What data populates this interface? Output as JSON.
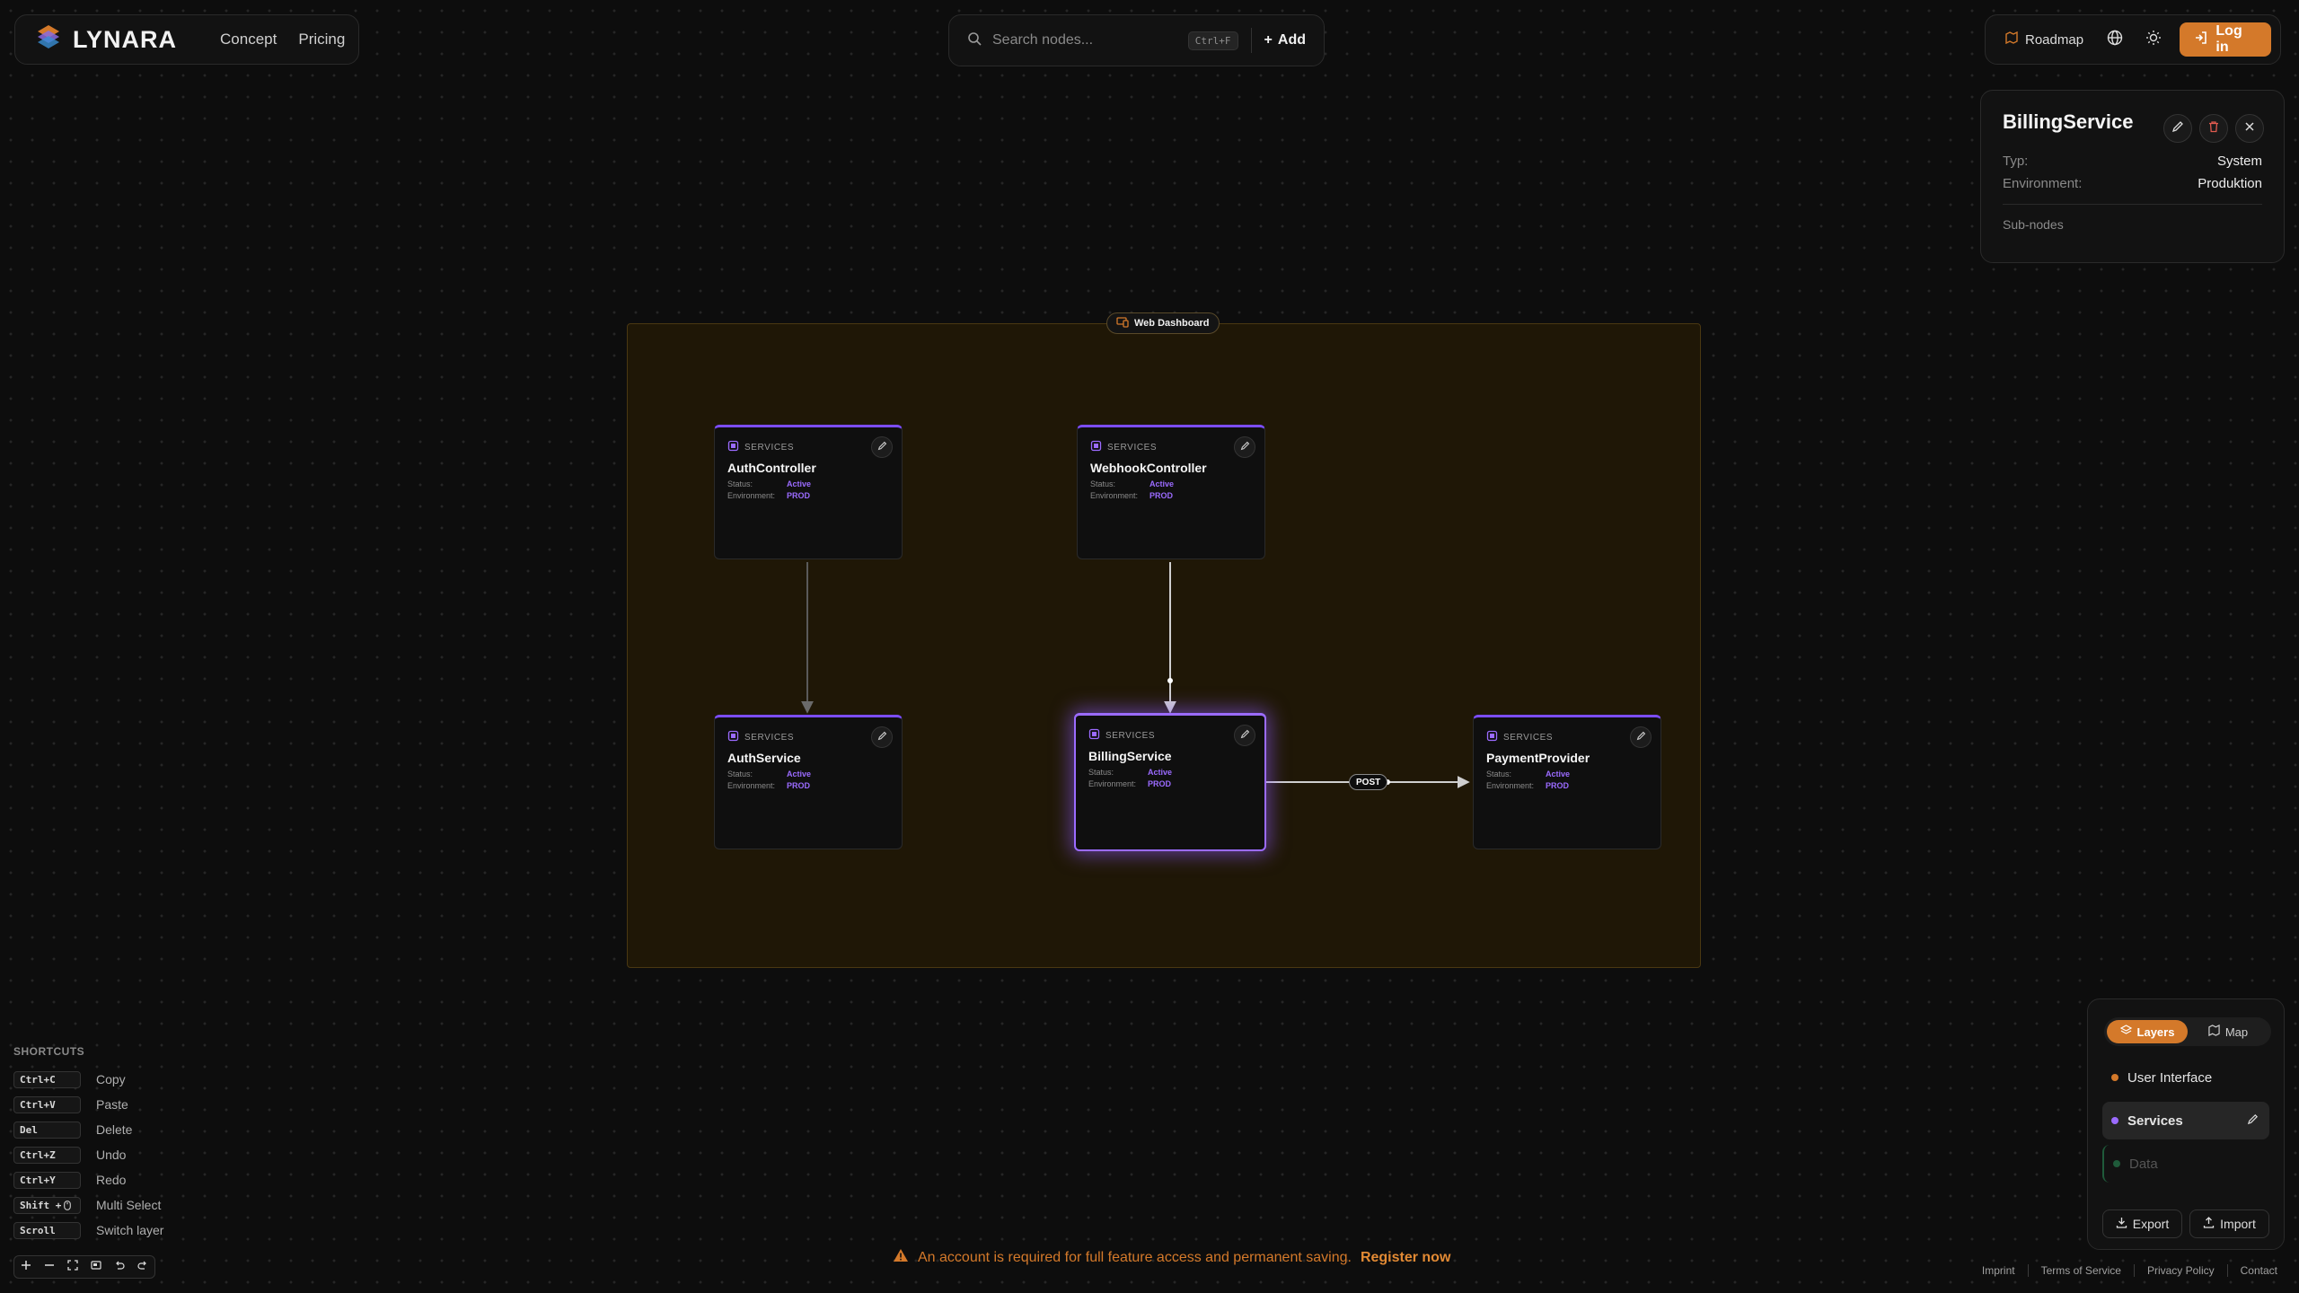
{
  "brand": {
    "name": "LYNARA"
  },
  "nav": {
    "links": [
      "Concept",
      "Pricing"
    ]
  },
  "search": {
    "placeholder": "Search nodes...",
    "shortcut": "Ctrl+F",
    "add_label": "Add"
  },
  "topbar": {
    "roadmap_label": "Roadmap",
    "login_label": "Log in"
  },
  "detail": {
    "title": "BillingService",
    "type_key": "Typ:",
    "type_value": "System",
    "env_key": "Environment:",
    "env_value": "Produktion",
    "subnodes_label": "Sub-nodes"
  },
  "container": {
    "label": "Web Dashboard",
    "color": "#d4792a"
  },
  "nodes": [
    {
      "category": "SERVICES",
      "name": "AuthController",
      "status_key": "Status:",
      "status": "Active",
      "env_key": "Environment:",
      "env": "PROD",
      "selected": false
    },
    {
      "category": "SERVICES",
      "name": "WebhookController",
      "status_key": "Status:",
      "status": "Active",
      "env_key": "Environment:",
      "env": "PROD",
      "selected": false
    },
    {
      "category": "SERVICES",
      "name": "AuthService",
      "status_key": "Status:",
      "status": "Active",
      "env_key": "Environment:",
      "env": "PROD",
      "selected": false
    },
    {
      "category": "SERVICES",
      "name": "BillingService",
      "status_key": "Status:",
      "status": "Active",
      "env_key": "Environment:",
      "env": "PROD",
      "selected": true
    },
    {
      "category": "SERVICES",
      "name": "PaymentProvider",
      "status_key": "Status:",
      "status": "Active",
      "env_key": "Environment:",
      "env": "PROD",
      "selected": false
    }
  ],
  "edges": [
    {
      "from": "AuthController",
      "to": "AuthService",
      "label": ""
    },
    {
      "from": "WebhookController",
      "to": "BillingService",
      "label": ""
    },
    {
      "from": "BillingService",
      "to": "PaymentProvider",
      "label": "POST"
    }
  ],
  "layers_panel": {
    "tabs": [
      "Layers",
      "Map"
    ],
    "active_tab": "Layers",
    "items": [
      {
        "label": "User Interface",
        "color": "#d4792a"
      },
      {
        "label": "Services",
        "color": "#9b6bff",
        "active": true
      },
      {
        "label": "Data",
        "color": "#1f5a3a",
        "disabled": true
      }
    ],
    "export_label": "Export",
    "import_label": "Import"
  },
  "shortcuts": {
    "heading": "SHORTCUTS",
    "items": [
      {
        "keys": "Ctrl+C",
        "action": "Copy"
      },
      {
        "keys": "Ctrl+V",
        "action": "Paste"
      },
      {
        "keys": "Del",
        "action": "Delete"
      },
      {
        "keys": "Ctrl+Z",
        "action": "Undo"
      },
      {
        "keys": "Ctrl+Y",
        "action": "Redo"
      },
      {
        "keys": "Shift + ",
        "action": "Multi Select"
      },
      {
        "keys": "Scroll",
        "action": "Switch layer"
      }
    ]
  },
  "banner": {
    "text": "An account is required for full feature access and permanent saving.",
    "link": "Register now"
  },
  "footer": {
    "links": [
      "Imprint",
      "Terms of Service",
      "Privacy Policy",
      "Contact"
    ]
  },
  "colors": {
    "accent": "#d4792a",
    "node_accent": "#9b6bff",
    "background": "#0d0d0d"
  }
}
